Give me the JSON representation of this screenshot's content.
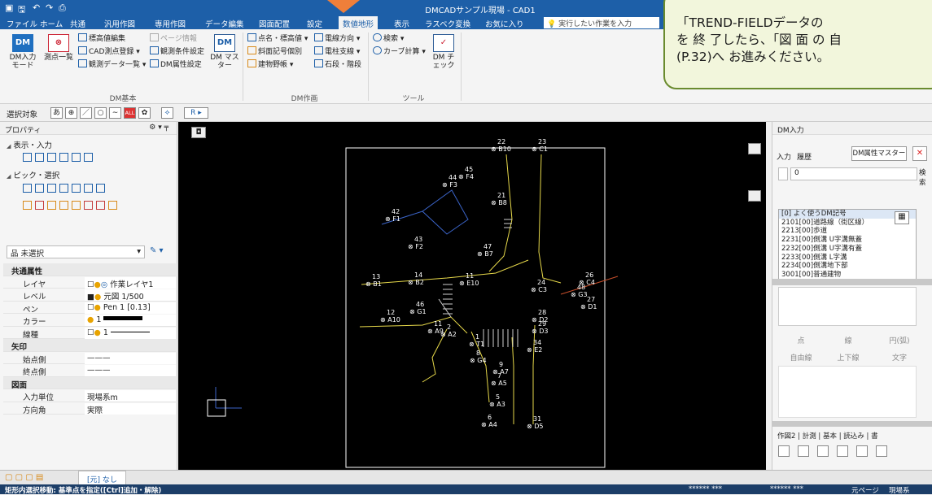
{
  "window": {
    "title": "DMCADサンプル現場 - CAD1"
  },
  "menu": {
    "tabs": [
      "ファイル",
      "ホーム",
      "共通",
      "汎用作図",
      "専用作図",
      "データ編集",
      "図面配置",
      "設定",
      "数値地形",
      "表示",
      "ラスベク変換",
      "お気に入り"
    ],
    "active_tab": "数値地形",
    "search_placeholder": "実行したい作業を入力"
  },
  "ribbon": {
    "dm_input": "DM入力 モード",
    "survey_list": "測点一覧",
    "elev_edit": "標高値編集",
    "cad_point": "CAD測点登録",
    "obs_data": "観測データ一覧",
    "page_info": "ページ情報",
    "obs_cond": "観測条件設定",
    "dm_attr": "DM属性設定",
    "dm_master": "DM マスター",
    "group_basic": "DM基本",
    "point_name": "点名・標高値",
    "slope": "斜面記号個別",
    "building": "建物野帳",
    "pole_dir": "電線方向",
    "pole_support": "電柱支線",
    "stone_step": "石段・階段",
    "group_draw": "DM作画",
    "search": "検索",
    "curve": "カーブ計算",
    "dm_check": "DM チェック",
    "group_tool": "ツール"
  },
  "callout": {
    "line1": "「TREND-FIELDデータの",
    "line2": "を 終 了したら、「図 面 の 自",
    "line3": "(P.32)へ お進みください。"
  },
  "selection_toolbar": {
    "label": "選択対象",
    "buttons": [
      "あ",
      "⊕",
      "／",
      "○",
      "∼",
      "ALL",
      "✿"
    ]
  },
  "left_panel": {
    "title": "プロパティ",
    "section_display": "表示・入力",
    "section_pick": "ピック・選択",
    "filter_value": "未選択",
    "groups": [
      {
        "name": "共通属性",
        "rows": [
          {
            "key": "レイヤ",
            "value": "作業レイヤ1"
          },
          {
            "key": "レベル",
            "value": "元図 1/500"
          },
          {
            "key": "ペン",
            "value": "Pen 1 [0.13]"
          },
          {
            "key": "カラー",
            "value": "1"
          },
          {
            "key": "線種",
            "value": "1"
          }
        ]
      },
      {
        "name": "矢印",
        "rows": [
          {
            "key": "始点側",
            "value": "———"
          },
          {
            "key": "終点側",
            "value": "———"
          }
        ]
      },
      {
        "name": "図面",
        "rows": [
          {
            "key": "入力単位",
            "value": "現場系m"
          },
          {
            "key": "方向角",
            "value": "実際"
          }
        ]
      }
    ]
  },
  "points": [
    {
      "label": "B10",
      "num": "22"
    },
    {
      "label": "C1",
      "num": "23"
    },
    {
      "label": "F4",
      "num": "45"
    },
    {
      "label": "F1",
      "num": "42"
    },
    {
      "label": "F3",
      "num": "44"
    },
    {
      "label": "F2",
      "num": "43"
    },
    {
      "label": "B8",
      "num": "21"
    },
    {
      "label": "B7",
      "num": "47"
    },
    {
      "label": "B1",
      "num": "13"
    },
    {
      "label": "B2",
      "num": "14"
    },
    {
      "label": "E10",
      "num": "11"
    },
    {
      "label": "C3",
      "num": "24"
    },
    {
      "label": "C4",
      "num": "26"
    },
    {
      "label": "G3",
      "num": "48"
    },
    {
      "label": "D1",
      "num": "27"
    },
    {
      "label": "G1",
      "num": "46"
    },
    {
      "label": "A10",
      "num": "12"
    },
    {
      "label": "A9",
      "num": "11"
    },
    {
      "label": "A2",
      "num": "2"
    },
    {
      "label": "T1",
      "num": "1"
    },
    {
      "label": "D2",
      "num": "28"
    },
    {
      "label": "D3",
      "num": "29"
    },
    {
      "label": "E2",
      "num": "34"
    },
    {
      "label": "G4",
      "num": "8"
    },
    {
      "label": "A7",
      "num": "9"
    },
    {
      "label": "A5",
      "num": "7"
    },
    {
      "label": "A3",
      "num": "5"
    },
    {
      "label": "A4",
      "num": "6"
    },
    {
      "label": "D5",
      "num": "31"
    }
  ],
  "right_panel": {
    "title": "DM入力",
    "tab_input": "入力",
    "tab_history": "履歴",
    "master_button": "DM属性マスター",
    "code_value": "0",
    "search_label": "検索",
    "list_header": "[0] よく使うDM記号",
    "items": [
      "2101[00]道路線（街区線）",
      "2213[00]歩道",
      "2231[00]側溝 U字溝無蓋",
      "2232[00]側溝 U字溝有蓋",
      "2233[00]側溝 L字溝",
      "2234[00]側溝地下部",
      "3001[00]普通建物"
    ],
    "buttons": [
      "点",
      "線",
      "円(弧)",
      "自由線",
      "上下線",
      "文字"
    ],
    "bottom_tabs": [
      "作図2",
      "計測",
      "基本",
      "読込み",
      "書"
    ]
  },
  "bottom": {
    "tab_label": "[元] なし"
  },
  "status": {
    "message": "矩形内選択移動: 基準点を指定([Ctrl]追加・解除)",
    "c1": "****** ***",
    "c2": "****** ***",
    "c3": "元ページ",
    "c4": "現場系"
  }
}
